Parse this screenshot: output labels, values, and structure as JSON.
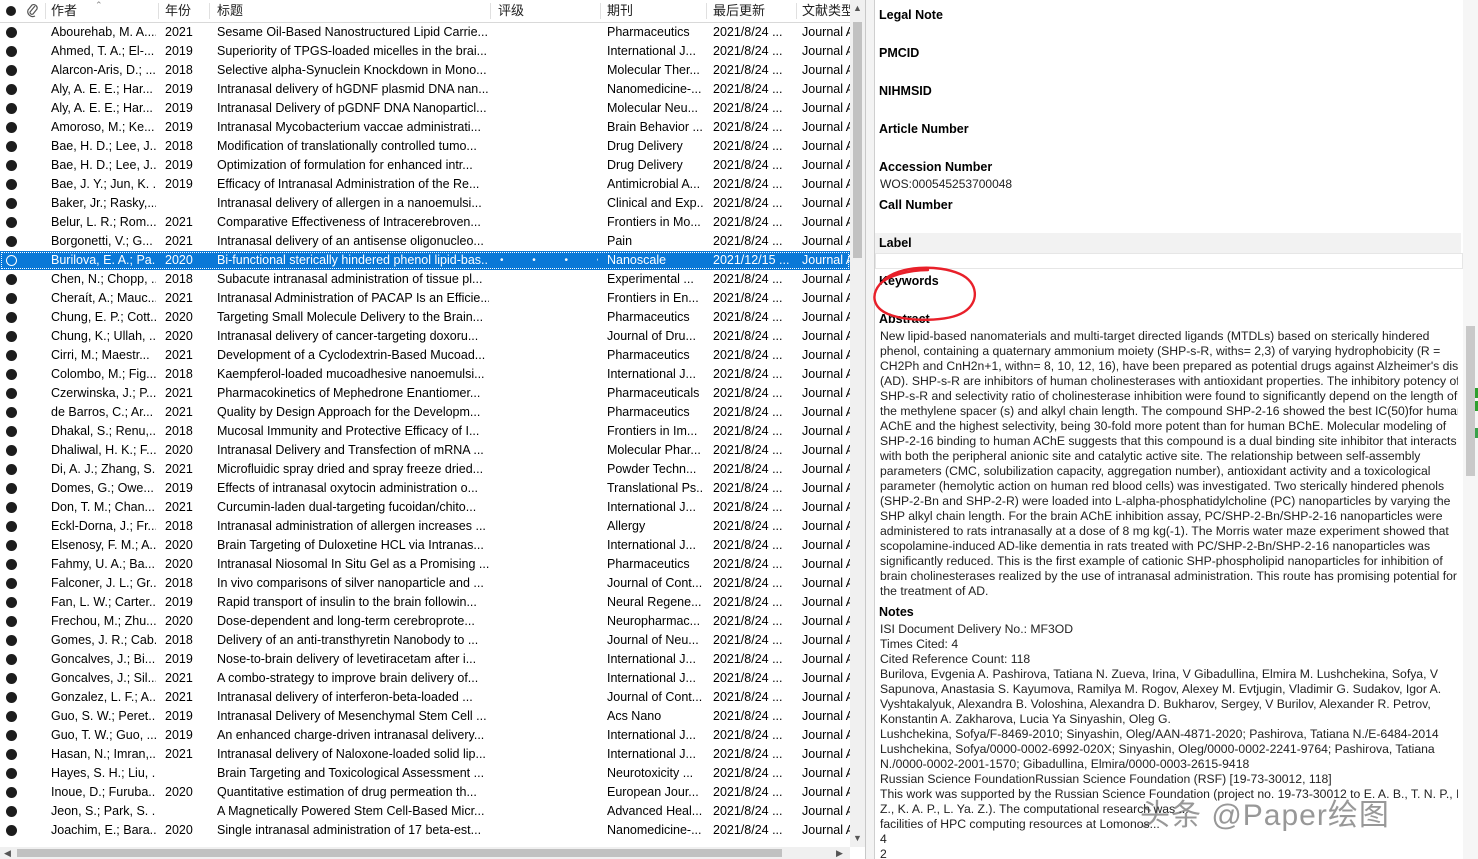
{
  "headers": {
    "author": "作者",
    "year": "年份",
    "title": "标题",
    "rating": "评级",
    "journal": "期刊",
    "updated": "最后更新",
    "type": "文献类型"
  },
  "rows": [
    {
      "author": "Abourehab, M. A....",
      "year": "2021",
      "title": "Sesame Oil-Based Nanostructured Lipid Carrie...",
      "rating": "",
      "journal": "Pharmaceutics",
      "updated": "2021/8/24 ...",
      "type": "Journal A"
    },
    {
      "author": "Ahmed, T. A.; El-...",
      "year": "2019",
      "title": "Superiority of TPGS-loaded micelles in the brai...",
      "rating": "",
      "journal": "International J...",
      "updated": "2021/8/24 ...",
      "type": "Journal A"
    },
    {
      "author": "Alarcon-Aris, D.; ...",
      "year": "2018",
      "title": "Selective alpha-Synuclein Knockdown in Mono...",
      "rating": "",
      "journal": "Molecular Ther...",
      "updated": "2021/8/24 ...",
      "type": "Journal A"
    },
    {
      "author": "Aly, A. E. E.; Har...",
      "year": "2019",
      "title": "Intranasal delivery of hGDNF plasmid DNA nan...",
      "rating": "",
      "journal": "Nanomedicine-...",
      "updated": "2021/8/24 ...",
      "type": "Journal A"
    },
    {
      "author": "Aly, A. E. E.; Har...",
      "year": "2019",
      "title": "Intranasal Delivery of pGDNF DNA Nanoparticl...",
      "rating": "",
      "journal": "Molecular Neu...",
      "updated": "2021/8/24 ...",
      "type": "Journal A"
    },
    {
      "author": "Amoroso, M.; Ke...",
      "year": "2019",
      "title": "Intranasal Mycobacterium vaccae administrati...",
      "rating": "",
      "journal": "Brain Behavior ...",
      "updated": "2021/8/24 ...",
      "type": "Journal A"
    },
    {
      "author": "Bae, H. D.; Lee, J....",
      "year": "2018",
      "title": "Modification of translationally controlled tumo...",
      "rating": "",
      "journal": "Drug Delivery",
      "updated": "2021/8/24 ...",
      "type": "Journal A"
    },
    {
      "author": "Bae, H. D.; Lee, J....",
      "year": "2019",
      "title": "Optimization of formulation for enhanced intr...",
      "rating": "",
      "journal": "Drug Delivery",
      "updated": "2021/8/24 ...",
      "type": "Journal A"
    },
    {
      "author": "Bae, J. Y.; Jun, K. ...",
      "year": "2019",
      "title": "Efficacy of Intranasal Administration of the Re...",
      "rating": "",
      "journal": "Antimicrobial A...",
      "updated": "2021/8/24 ...",
      "type": "Journal A"
    },
    {
      "author": "Baker, Jr.; Rasky,...",
      "year": "",
      "title": "Intranasal delivery of allergen in a nanoemulsi...",
      "rating": "",
      "journal": "Clinical and Exp...",
      "updated": "2021/8/24 ...",
      "type": "Journal A"
    },
    {
      "author": "Belur, L. R.; Rom...",
      "year": "2021",
      "title": "Comparative Effectiveness of Intracerebroven...",
      "rating": "",
      "journal": "Frontiers in Mo...",
      "updated": "2021/8/24 ...",
      "type": "Journal A"
    },
    {
      "author": "Borgonetti, V.; G...",
      "year": "2021",
      "title": "Intranasal delivery of an antisense oligonucleo...",
      "rating": "",
      "journal": "Pain",
      "updated": "2021/8/24 ...",
      "type": "Journal A"
    },
    {
      "author": "Burilova, E. A.; Pa...",
      "year": "2020",
      "title": "Bi-functional sterically hindered phenol lipid-bas...",
      "rating": "• • • • •",
      "journal": "Nanoscale",
      "updated": "2021/12/15 ...",
      "type": "Journal A",
      "selected": true
    },
    {
      "author": "Chen, N.; Chopp, ...",
      "year": "2018",
      "title": "Subacute intranasal administration of tissue pl...",
      "rating": "",
      "journal": "Experimental ...",
      "updated": "2021/8/24 ...",
      "type": "Journal A"
    },
    {
      "author": "Cheraít, A.; Mauc...",
      "year": "2021",
      "title": "Intranasal Administration of PACAP Is an Efficie...",
      "rating": "",
      "journal": "Frontiers in En...",
      "updated": "2021/8/24 ...",
      "type": "Journal A"
    },
    {
      "author": "Chung, E. P.; Cott...",
      "year": "2020",
      "title": "Targeting Small Molecule Delivery to the Brain...",
      "rating": "",
      "journal": "Pharmaceutics",
      "updated": "2021/8/24 ...",
      "type": "Journal A"
    },
    {
      "author": "Chung, K.; Ullah, ...",
      "year": "2020",
      "title": "Intranasal delivery of cancer-targeting doxoru...",
      "rating": "",
      "journal": "Journal of Dru...",
      "updated": "2021/8/24 ...",
      "type": "Journal A"
    },
    {
      "author": "Cirri, M.; Maestr...",
      "year": "2021",
      "title": "Development of a Cyclodextrin-Based Mucoad...",
      "rating": "",
      "journal": "Pharmaceutics",
      "updated": "2021/8/24 ...",
      "type": "Journal A"
    },
    {
      "author": "Colombo, M.; Fig...",
      "year": "2018",
      "title": "Kaempferol-loaded mucoadhesive nanoemulsi...",
      "rating": "",
      "journal": "International J...",
      "updated": "2021/8/24 ...",
      "type": "Journal A"
    },
    {
      "author": "Czerwinska, J.; P...",
      "year": "2021",
      "title": "Pharmacokinetics of Mephedrone Enantiomer...",
      "rating": "",
      "journal": "Pharmaceuticals",
      "updated": "2021/8/24 ...",
      "type": "Journal A"
    },
    {
      "author": "de Barros, C.; Ar...",
      "year": "2021",
      "title": "Quality by Design Approach for the Developm...",
      "rating": "",
      "journal": "Pharmaceutics",
      "updated": "2021/8/24 ...",
      "type": "Journal A"
    },
    {
      "author": "Dhakal, S.; Renu,...",
      "year": "2018",
      "title": "Mucosal Immunity and Protective Efficacy of I...",
      "rating": "",
      "journal": "Frontiers in Im...",
      "updated": "2021/8/24 ...",
      "type": "Journal A"
    },
    {
      "author": "Dhaliwal, H. K.; F...",
      "year": "2020",
      "title": "Intranasal Delivery and Transfection of mRNA ...",
      "rating": "",
      "journal": "Molecular Phar...",
      "updated": "2021/8/24 ...",
      "type": "Journal A"
    },
    {
      "author": "Di, A. J.; Zhang, S...",
      "year": "2021",
      "title": "Microfluidic spray dried and spray freeze dried...",
      "rating": "",
      "journal": "Powder Techn...",
      "updated": "2021/8/24 ...",
      "type": "Journal A"
    },
    {
      "author": "Domes, G.; Owe...",
      "year": "2019",
      "title": "Effects of intranasal oxytocin administration o...",
      "rating": "",
      "journal": "Translational Ps...",
      "updated": "2021/8/24 ...",
      "type": "Journal A"
    },
    {
      "author": "Don, T. M.; Chan...",
      "year": "2021",
      "title": "Curcumin-laden dual-targeting fucoidan/chito...",
      "rating": "",
      "journal": "International J...",
      "updated": "2021/8/24 ...",
      "type": "Journal A"
    },
    {
      "author": "Eckl-Dorna, J.; Fr...",
      "year": "2018",
      "title": "Intranasal administration of allergen increases ...",
      "rating": "",
      "journal": "Allergy",
      "updated": "2021/8/24 ...",
      "type": "Journal A"
    },
    {
      "author": "Elsenosy, F. M.; A...",
      "year": "2020",
      "title": "Brain Targeting of Duloxetine HCL via Intranas...",
      "rating": "",
      "journal": "International J...",
      "updated": "2021/8/24 ...",
      "type": "Journal A"
    },
    {
      "author": "Fahmy, U. A.; Ba...",
      "year": "2020",
      "title": "Intranasal Niosomal In Situ Gel as a Promising ...",
      "rating": "",
      "journal": "Pharmaceutics",
      "updated": "2021/8/24 ...",
      "type": "Journal A"
    },
    {
      "author": "Falconer, J. L.; Gr...",
      "year": "2018",
      "title": "In vivo comparisons of silver nanoparticle and ...",
      "rating": "",
      "journal": "Journal of Cont...",
      "updated": "2021/8/24 ...",
      "type": "Journal A"
    },
    {
      "author": "Fan, L. W.; Carter...",
      "year": "2019",
      "title": "Rapid transport of insulin to the brain followin...",
      "rating": "",
      "journal": "Neural Regene...",
      "updated": "2021/8/24 ...",
      "type": "Journal A"
    },
    {
      "author": "Frechou, M.; Zhu...",
      "year": "2020",
      "title": "Dose-dependent and long-term cerebroprote...",
      "rating": "",
      "journal": "Neuropharmac...",
      "updated": "2021/8/24 ...",
      "type": "Journal A"
    },
    {
      "author": "Gomes, J. R.; Cab...",
      "year": "2018",
      "title": "Delivery of an anti-transthyretin Nanobody to ...",
      "rating": "",
      "journal": "Journal of Neu...",
      "updated": "2021/8/24 ...",
      "type": "Journal A"
    },
    {
      "author": "Goncalves, J.; Bi...",
      "year": "2019",
      "title": "Nose-to-brain delivery of levetiracetam after i...",
      "rating": "",
      "journal": "International J...",
      "updated": "2021/8/24 ...",
      "type": "Journal A"
    },
    {
      "author": "Goncalves, J.; Sil...",
      "year": "2021",
      "title": "A combo-strategy to improve brain delivery of...",
      "rating": "",
      "journal": "International J...",
      "updated": "2021/8/24 ...",
      "type": "Journal A"
    },
    {
      "author": "Gonzalez, L. F.; A...",
      "year": "2021",
      "title": "Intranasal delivery of interferon-beta-loaded ...",
      "rating": "",
      "journal": "Journal of Cont...",
      "updated": "2021/8/24 ...",
      "type": "Journal A"
    },
    {
      "author": "Guo, S. W.; Peret...",
      "year": "2019",
      "title": "Intranasal Delivery of Mesenchymal Stem Cell ...",
      "rating": "",
      "journal": "Acs Nano",
      "updated": "2021/8/24 ...",
      "type": "Journal A"
    },
    {
      "author": "Guo, T. W.; Guo, ...",
      "year": "2019",
      "title": "An enhanced charge-driven intranasal delivery...",
      "rating": "",
      "journal": "International J...",
      "updated": "2021/8/24 ...",
      "type": "Journal A"
    },
    {
      "author": "Hasan, N.; Imran,...",
      "year": "2021",
      "title": "Intranasal delivery of Naloxone-loaded solid lip...",
      "rating": "",
      "journal": "International J...",
      "updated": "2021/8/24 ...",
      "type": "Journal A"
    },
    {
      "author": "Hayes, S. H.; Liu, ...",
      "year": "",
      "title": "Brain Targeting and Toxicological Assessment ...",
      "rating": "",
      "journal": "Neurotoxicity ...",
      "updated": "2021/8/24 ...",
      "type": "Journal A"
    },
    {
      "author": "Inoue, D.; Furuba...",
      "year": "2020",
      "title": "Quantitative estimation of drug permeation th...",
      "rating": "",
      "journal": "European Jour...",
      "updated": "2021/8/24 ...",
      "type": "Journal A"
    },
    {
      "author": "Jeon, S.; Park, S. ...",
      "year": "",
      "title": "A Magnetically Powered Stem Cell-Based Micr...",
      "rating": "",
      "journal": "Advanced Heal...",
      "updated": "2021/8/24 ...",
      "type": "Journal A"
    },
    {
      "author": "Joachim, E.; Bara...",
      "year": "2020",
      "title": "Single intranasal administration of 17 beta-est...",
      "rating": "",
      "journal": "Nanomedicine-...",
      "updated": "2021/8/24 ...",
      "type": "Journal A"
    }
  ],
  "detail": {
    "legal_note_label": "Legal Note",
    "pmcid_label": "PMCID",
    "nihmsid_label": "NIHMSID",
    "article_number_label": "Article Number",
    "accession_number_label": "Accession Number",
    "accession_number_value": "WOS:000545253700048",
    "call_number_label": "Call Number",
    "label_label": "Label",
    "keywords_label": "Keywords",
    "abstract_label": "Abstract",
    "abstract_lines": [
      "New lipid-based nanomaterials and multi-target directed ligands (MTDLs) based on sterically hindered",
      "phenol, containing a quaternary ammonium moiety (SHP-s-R, withs= 2,3) of varying hydrophobicity (R =",
      "CH2Ph and CnH2n+1, withn= 8, 10, 12, 16), have been prepared as potential drugs against Alzheimer's disease",
      "(AD). SHP-s-R are inhibitors of human cholinesterases with antioxidant properties. The inhibitory potency of",
      "SHP-s-R and selectivity ratio of cholinesterase inhibition were found to significantly depend on the length of",
      "the methylene spacer (s) and alkyl chain length. The compound SHP-2-16 showed the best IC(50)for human",
      "AChE and the highest selectivity, being 30-fold more potent than for human BChE. Molecular modeling of",
      "SHP-2-16 binding to human AChE suggests that this compound is a dual binding site inhibitor that interacts",
      "with both the peripheral anionic site and catalytic active site. The relationship between self-assembly",
      "parameters (CMC, solubilization capacity, aggregation number), antioxidant activity and a toxicological",
      "parameter (hemolytic action on human red blood cells) was investigated. Two sterically hindered phenols",
      "(SHP-2-Bn and SHP-2-R) were loaded into L-alpha-phosphatidylcholine (PC) nanoparticles by varying the",
      "SHP alkyl chain length. For the brain AChE inhibition assay, PC/SHP-2-Bn/SHP-2-16 nanoparticles were",
      "administered to rats intranasally at a dose of 8 mg kg(-1). The Morris water maze experiment showed that",
      "scopolamine-induced AD-like dementia in rats treated with PC/SHP-2-Bn/SHP-2-16 nanoparticles was",
      "significantly reduced. This is the first example of cationic SHP-phospholipid nanoparticles for inhibition of",
      "brain cholinesterases realized by the use of intranasal administration. This route has promising potential for",
      "the treatment of AD."
    ],
    "notes_label": "Notes",
    "notes_lines": [
      "ISI Document Delivery No.: MF3OD",
      "Times Cited: 4",
      "Cited Reference Count: 118",
      "Burilova, Evgenia A. Pashirova, Tatiana N. Zueva, Irina, V Gibadullina, Elmira M. Lushchekina, Sofya, V",
      "Sapunova, Anastasia S. Kayumova, Ramilya M. Rogov, Alexey M. Evtjugin, Vladimir G. Sudakov, Igor A.",
      "Vyshtakalyuk, Alexandra B. Voloshina, Alexandra D. Bukharov, Sergey, V Burilov, Alexander R. Petrov,",
      "Konstantin A. Zakharova, Lucia Ya Sinyashin, Oleg G.",
      "Lushchekina, Sofya/F-8469-2010; Sinyashin, Oleg/AAN-4871-2020; Pashirova, Tatiana N./E-6484-2014",
      "Lushchekina, Sofya/0000-0002-6992-020X; Sinyashin, Oleg/0000-0002-2241-9764; Pashirova, Tatiana",
      "N./0000-0002-2001-1570; Gibadullina, Elmira/0000-0003-2615-9418",
      "Russian Science FoundationRussian Science Foundation (RSF) [19-73-30012, 118]",
      "This work was supported by the Russian Science Foundation (project no. 19-73-30012 to E. A. B., T. N. P., I. V.",
      "Z., K. A. P., L. Ya. Z.). The computational research was ...",
      "facilities of HPC computing resources at Lomonos...",
      "4",
      "2"
    ]
  },
  "watermark": "头条 @Paper绘图",
  "colors": {
    "selection": "#0a78d7",
    "annotation_circle": "#e8202a"
  }
}
